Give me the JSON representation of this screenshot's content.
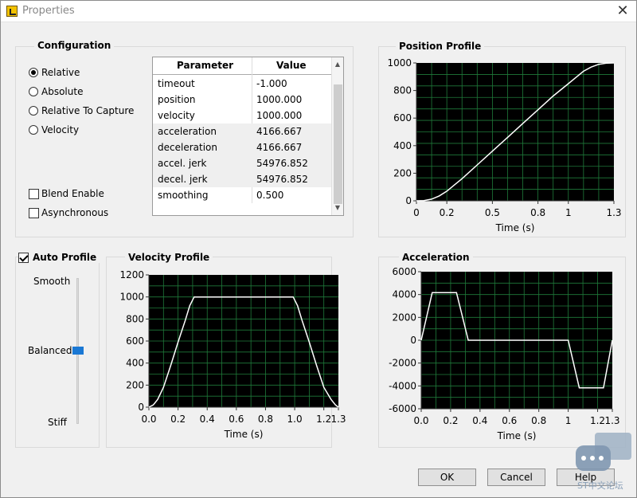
{
  "window": {
    "title": "Properties",
    "close_glyph": "✕",
    "icon": "labview-app-icon"
  },
  "configuration": {
    "title": "Configuration",
    "modes": [
      {
        "label": "Relative",
        "selected": true
      },
      {
        "label": "Absolute",
        "selected": false
      },
      {
        "label": "Relative To Capture",
        "selected": false
      },
      {
        "label": "Velocity",
        "selected": false
      }
    ],
    "checkboxes": [
      {
        "label": "Blend Enable",
        "checked": false
      },
      {
        "label": "Asynchronous",
        "checked": false
      }
    ],
    "table": {
      "headers": [
        "Parameter",
        "Value"
      ],
      "rows": [
        {
          "param": "timeout",
          "value": "-1.000"
        },
        {
          "param": "position",
          "value": "1000.000"
        },
        {
          "param": "velocity",
          "value": "1000.000"
        },
        {
          "param": "acceleration",
          "value": "4166.667"
        },
        {
          "param": "deceleration",
          "value": "4166.667"
        },
        {
          "param": "accel. jerk",
          "value": "54976.852"
        },
        {
          "param": "decel. jerk",
          "value": "54976.852"
        },
        {
          "param": "smoothing",
          "value": "0.500"
        }
      ]
    }
  },
  "auto_profile": {
    "label": "Auto Profile",
    "checked": true,
    "slider_labels": [
      "Smooth",
      "Balanced",
      "Stiff"
    ],
    "slider_value": "Balanced",
    "accent": "#1a78d4"
  },
  "buttons": {
    "ok": "OK",
    "cancel": "Cancel",
    "help": "Help"
  },
  "watermark_text": "ST中文论坛",
  "chart_data": [
    {
      "type": "line",
      "title": "Position Profile",
      "xlabel": "Time (s)",
      "ylabel": "",
      "xlim": [
        0,
        1.3
      ],
      "ylim": [
        0,
        1000
      ],
      "xticks": [
        "0",
        "0.2",
        "0.5",
        "0.8",
        "1",
        "1.3"
      ],
      "xtick_values": [
        0,
        0.2,
        0.5,
        0.8,
        1.0,
        1.3
      ],
      "yticks": [
        "0",
        "200",
        "400",
        "600",
        "800",
        "1000"
      ],
      "ytick_values": [
        0,
        200,
        400,
        600,
        800,
        1000
      ],
      "grid": true,
      "background": "#000000",
      "grid_color": "#1f7a3a",
      "line_color": "#ffffff",
      "series": [
        {
          "x": [
            0,
            0.05,
            0.1,
            0.15,
            0.2,
            0.25,
            0.3,
            0.4,
            0.5,
            0.6,
            0.7,
            0.8,
            0.9,
            1.0,
            1.05,
            1.1,
            1.15,
            1.2,
            1.25,
            1.3
          ],
          "y": [
            0,
            2,
            12,
            35,
            70,
            115,
            160,
            260,
            360,
            460,
            560,
            660,
            760,
            850,
            895,
            940,
            970,
            990,
            998,
            1000
          ]
        }
      ]
    },
    {
      "type": "line",
      "title": "Velocity Profile",
      "xlabel": "Time (s)",
      "ylabel": "",
      "xlim": [
        0,
        1.3
      ],
      "ylim": [
        0,
        1200
      ],
      "xticks": [
        "0.0",
        "0.2",
        "0.4",
        "0.6",
        "0.8",
        "1.0",
        "1.2",
        "1.3"
      ],
      "xtick_values": [
        0,
        0.2,
        0.4,
        0.6,
        0.8,
        1.0,
        1.2,
        1.3
      ],
      "yticks": [
        "0",
        "200",
        "400",
        "600",
        "800",
        "1000",
        "1200"
      ],
      "ytick_values": [
        0,
        200,
        400,
        600,
        800,
        1000,
        1200
      ],
      "grid": true,
      "background": "#000000",
      "grid_color": "#1f7a3a",
      "line_color": "#ffffff",
      "series": [
        {
          "x": [
            0,
            0.03,
            0.06,
            0.1,
            0.15,
            0.2,
            0.25,
            0.28,
            0.31,
            0.5,
            0.8,
            0.99,
            1.02,
            1.05,
            1.1,
            1.15,
            1.2,
            1.25,
            1.28,
            1.3
          ],
          "y": [
            0,
            20,
            70,
            180,
            380,
            590,
            790,
            920,
            1000,
            1000,
            1000,
            1000,
            920,
            790,
            590,
            380,
            180,
            70,
            20,
            0
          ]
        }
      ]
    },
    {
      "type": "line",
      "title": "Acceleration",
      "xlabel": "Time (s)",
      "ylabel": "",
      "xlim": [
        0,
        1.3
      ],
      "ylim": [
        -6000,
        6000
      ],
      "xticks": [
        "0.0",
        "0.2",
        "0.4",
        "0.6",
        "0.8",
        "1",
        "1.2",
        "1.3"
      ],
      "xtick_values": [
        0,
        0.2,
        0.4,
        0.6,
        0.8,
        1.0,
        1.2,
        1.3
      ],
      "yticks": [
        "-6000",
        "-4000",
        "-2000",
        "0",
        "2000",
        "4000",
        "6000"
      ],
      "ytick_values": [
        -6000,
        -4000,
        -2000,
        0,
        2000,
        4000,
        6000
      ],
      "grid": true,
      "background": "#000000",
      "grid_color": "#1f7a3a",
      "line_color": "#ffffff",
      "series": [
        {
          "x": [
            0,
            0.075,
            0.24,
            0.32,
            1.0,
            1.075,
            1.24,
            1.3
          ],
          "y": [
            0,
            4167,
            4167,
            0,
            0,
            -4167,
            -4167,
            0
          ]
        }
      ]
    }
  ]
}
